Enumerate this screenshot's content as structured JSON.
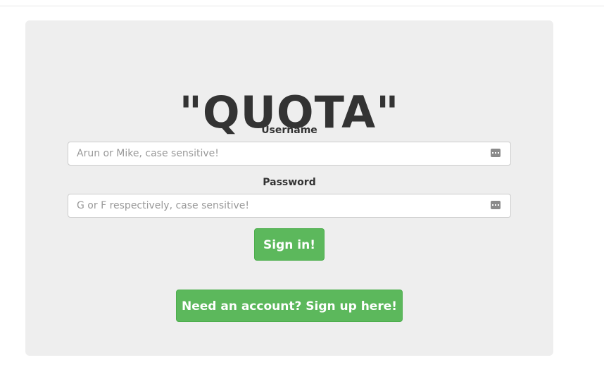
{
  "page": {
    "title": "\"QUOTA\""
  },
  "form": {
    "username_label": "Username",
    "username_placeholder": "Arun or Mike, case sensitive!",
    "password_label": "Password",
    "password_placeholder": "G or F respectively, case sensitive!",
    "signin_label": "Sign in!",
    "signup_label": "Need an account? Sign up here!"
  },
  "colors": {
    "panel_bg": "#eeeeee",
    "button_bg": "#5cb85c",
    "title_text": "#333333"
  },
  "icons": {
    "field_icon": "password-manager-key-icon"
  }
}
